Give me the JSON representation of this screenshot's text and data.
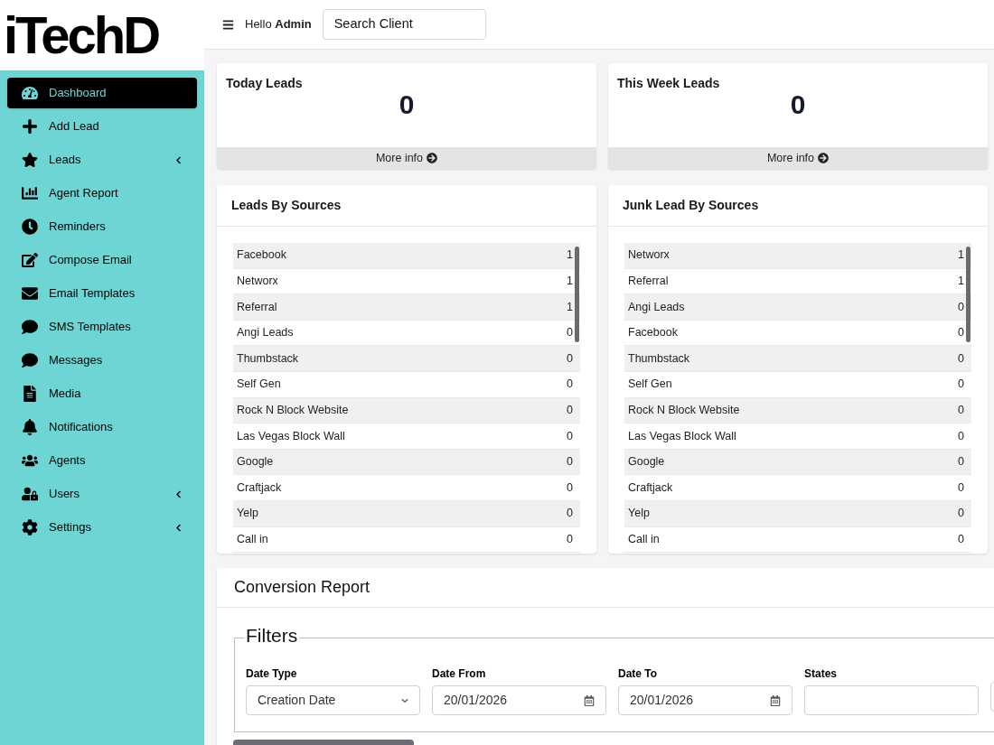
{
  "logo": {
    "text": "iTechD"
  },
  "sidebar": {
    "items": [
      {
        "label": "Dashboard",
        "selected": true,
        "expandable": false
      },
      {
        "label": "Add Lead",
        "selected": false,
        "expandable": false
      },
      {
        "label": "Leads",
        "selected": false,
        "expandable": true
      },
      {
        "label": "Agent Report",
        "selected": false,
        "expandable": false
      },
      {
        "label": "Reminders",
        "selected": false,
        "expandable": false
      },
      {
        "label": "Compose Email",
        "selected": false,
        "expandable": false
      },
      {
        "label": "Email Templates",
        "selected": false,
        "expandable": false
      },
      {
        "label": "SMS Templates",
        "selected": false,
        "expandable": false
      },
      {
        "label": "Messages",
        "selected": false,
        "expandable": false
      },
      {
        "label": "Media",
        "selected": false,
        "expandable": false
      },
      {
        "label": "Notifications",
        "selected": false,
        "expandable": false
      },
      {
        "label": "Agents",
        "selected": false,
        "expandable": false
      },
      {
        "label": "Users",
        "selected": false,
        "expandable": true
      },
      {
        "label": "Settings",
        "selected": false,
        "expandable": true
      }
    ]
  },
  "header": {
    "greeting": "Hello",
    "user": "Admin",
    "search": {
      "value": "Search Client"
    }
  },
  "stats": [
    {
      "title": "Today Leads",
      "value": "0",
      "link": "More info"
    },
    {
      "title": "This Week Leads",
      "value": "0",
      "link": "More info"
    }
  ],
  "source_lists": [
    {
      "title": "Leads By Sources",
      "rows": [
        [
          "Facebook",
          "1"
        ],
        [
          "Networx",
          "1"
        ],
        [
          "Referral",
          "1"
        ],
        [
          "Angi Leads",
          "0"
        ],
        [
          "Thumbstack",
          "0"
        ],
        [
          "Self Gen",
          "0"
        ],
        [
          "Rock N Block Website",
          "0"
        ],
        [
          "Las Vegas Block Wall",
          "0"
        ],
        [
          "Google",
          "0"
        ],
        [
          "Craftjack",
          "0"
        ],
        [
          "Yelp",
          "0"
        ],
        [
          "Call in",
          "0"
        ]
      ]
    },
    {
      "title": "Junk Lead By Sources",
      "rows": [
        [
          "Networx",
          "1"
        ],
        [
          "Referral",
          "1"
        ],
        [
          "Angi Leads",
          "0"
        ],
        [
          "Facebook",
          "0"
        ],
        [
          "Thumbstack",
          "0"
        ],
        [
          "Self Gen",
          "0"
        ],
        [
          "Rock N Block Website",
          "0"
        ],
        [
          "Las Vegas Block Wall",
          "0"
        ],
        [
          "Google",
          "0"
        ],
        [
          "Craftjack",
          "0"
        ],
        [
          "Yelp",
          "0"
        ],
        [
          "Call in",
          "0"
        ]
      ]
    }
  ],
  "conversion_report": {
    "title": "Conversion Report",
    "filters": {
      "legend": "Filters",
      "fields": [
        {
          "kind": "select",
          "label": "Date Type",
          "value": "Creation Date"
        },
        {
          "kind": "date",
          "label": "Date From",
          "value": "20/01/2026"
        },
        {
          "kind": "date",
          "label": "Date To",
          "value": "20/01/2026"
        },
        {
          "kind": "text",
          "label": "States"
        },
        {
          "kind": "text"
        }
      ]
    }
  }
}
